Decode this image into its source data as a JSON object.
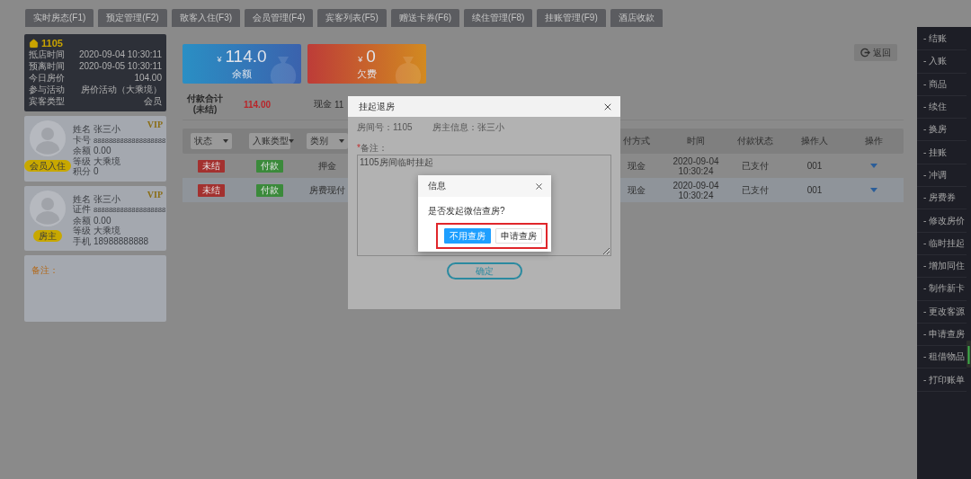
{
  "top_tabs": [
    "实时房态(F1)",
    "预定管理(F2)",
    "散客入住(F3)",
    "会员管理(F4)",
    "宾客列表(F5)",
    "赠送卡券(F6)",
    "续住管理(F8)",
    "挂账管理(F9)",
    "酒店收款"
  ],
  "room_card": {
    "room": "1105",
    "rows": [
      {
        "label": "抵店时间",
        "value": "2020-09-04 10:30:11"
      },
      {
        "label": "预离时间",
        "value": "2020-09-05 10:30:11"
      },
      {
        "label": "今日房价",
        "value": "104.00"
      },
      {
        "label": "参与活动",
        "value": "房价活动（大乘境）"
      },
      {
        "label": "宾客类型",
        "value": "会员"
      }
    ]
  },
  "guests": [
    {
      "badge": "会员入住",
      "vip": "VIP",
      "fields": [
        {
          "label": "姓名",
          "value": "张三小",
          "kind": "text"
        },
        {
          "label": "卡号",
          "value": "8888888888888888888",
          "kind": "number"
        },
        {
          "label": "余额",
          "value": "0.00",
          "kind": "text"
        },
        {
          "label": "等级",
          "value": "大乘境",
          "kind": "text"
        },
        {
          "label": "积分",
          "value": "0",
          "kind": "text"
        }
      ]
    },
    {
      "badge": "房主",
      "vip": "VIP",
      "fields": [
        {
          "label": "姓名",
          "value": "张三小",
          "kind": "text"
        },
        {
          "label": "证件",
          "value": "8888888888888888888",
          "kind": "number"
        },
        {
          "label": "余额",
          "value": "0.00",
          "kind": "text"
        },
        {
          "label": "等级",
          "value": "大乘境",
          "kind": "text"
        },
        {
          "label": "手机",
          "value": "18988888888",
          "kind": "text"
        }
      ]
    }
  ],
  "notes": {
    "label": "备注："
  },
  "balance_cards": [
    {
      "kind": "balance",
      "currency": "¥",
      "amount": "114.0",
      "label": "余额"
    },
    {
      "kind": "arrears",
      "currency": "¥",
      "amount": "0",
      "label": "欠费"
    }
  ],
  "return_button": "返回",
  "summary": {
    "label_line1": "付款合计",
    "label_line2": "(未结)",
    "total": "114.00",
    "cash_label": "现金",
    "cash_value": "11"
  },
  "filters": [
    "状态",
    "入账类型",
    "类别"
  ],
  "columns": [
    "付方式",
    "时间",
    "付款状态",
    "操作人",
    "操作"
  ],
  "rows": [
    {
      "status": "未结",
      "type": "付款",
      "category": "押金",
      "pay_method": "现金",
      "date": "2020-09-04",
      "clock": "10:30:24",
      "pay_status": "已支付",
      "operator": "001"
    },
    {
      "status": "未结",
      "type": "付款",
      "category": "房费现付",
      "pay_method": "现金",
      "date": "2020-09-04",
      "clock": "10:30:24",
      "pay_status": "已支付",
      "operator": "001"
    }
  ],
  "sidebar": [
    "- 结账",
    "- 入账",
    "- 商品",
    "- 续住",
    "- 换房",
    "- 挂账",
    "- 冲调",
    "- 房费券",
    "- 修改房价",
    "- 临时挂起",
    "- 增加同住",
    "- 制作新卡",
    "- 更改客源",
    "- 申请查房",
    "- 租借物品",
    "- 打印账单"
  ],
  "dialog": {
    "title": "挂起退房",
    "room_info": "房间号：1105",
    "owner_info": "房主信息：张三小",
    "required_mark": "*",
    "note_label": "备注：",
    "note_value": "1105房间临时挂起",
    "confirm": "确定"
  },
  "confirm_dialog": {
    "title": "信息",
    "message": "是否发起微信查房?",
    "buttons": [
      {
        "label": "不用查房",
        "kind": "primary"
      },
      {
        "label": "申请查房",
        "kind": "secondary"
      }
    ]
  }
}
